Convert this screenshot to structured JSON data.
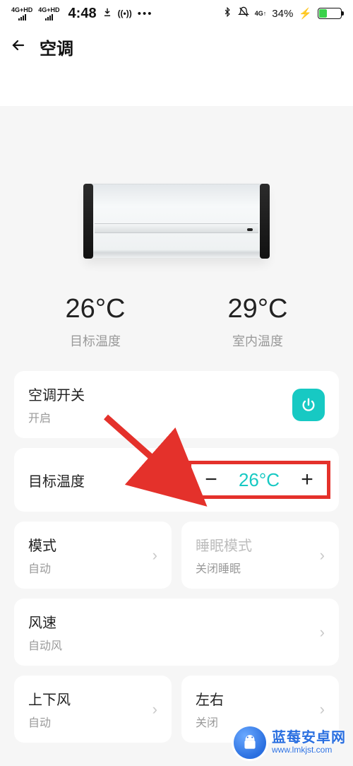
{
  "status": {
    "net1": "4G+HD",
    "net2": "4G+HD",
    "time": "4:48",
    "signal_4g": "4G↑",
    "battery_pct": "34%"
  },
  "nav": {
    "title": "空调"
  },
  "temps": {
    "target_value": "26°C",
    "target_label": "目标温度",
    "room_value": "29°C",
    "room_label": "室内温度"
  },
  "power": {
    "title": "空调开关",
    "state": "开启"
  },
  "target_ctrl": {
    "label": "目标温度",
    "value": "26°C"
  },
  "mode": {
    "title": "模式",
    "value": "自动"
  },
  "sleep": {
    "title": "睡眠模式",
    "value": "关闭睡眠"
  },
  "fan": {
    "title": "风速",
    "value": "自动风"
  },
  "swing_v": {
    "title": "上下风",
    "value": "自动"
  },
  "swing_h": {
    "title_partial": "左右",
    "value_partial": "关闭"
  },
  "watermark": {
    "brand": "蓝莓安卓网",
    "url": "www.lmkjst.com"
  }
}
